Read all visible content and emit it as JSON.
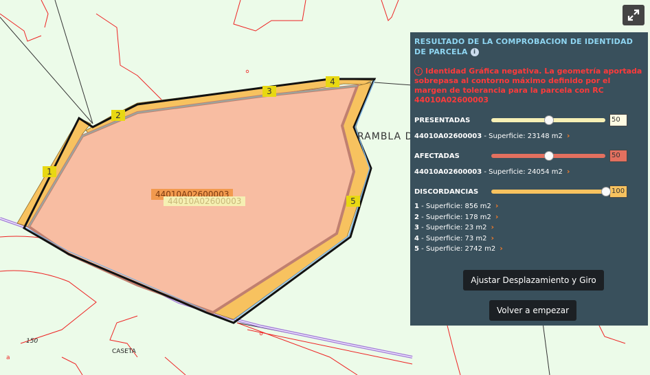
{
  "map": {
    "parcel_label_main": "44010A02600003",
    "parcel_label_shadow": "44010A02600003",
    "place_label": "RAMBLA D",
    "elevation_label": "150",
    "caseta_label": "CASETA",
    "red_letter": "a",
    "vertex_labels": [
      "1",
      "2",
      "3",
      "4",
      "5"
    ]
  },
  "toolbar": {
    "expand_icon": "expand-icon"
  },
  "panel": {
    "title_line1": "RESULTADO DE LA COMPROBACION DE IDENTIDAD",
    "title_line2": "DE PARCELA",
    "info_symbol": "i",
    "error_symbol": "!",
    "error_message": "Identidad Gráfica negativa. La geometría aportada sobrepasa al contorno máximo definido por el margen de tolerancia para la parcela con RC 44010A02600003",
    "presentadas": {
      "label": "PRESENTADAS",
      "value": "50",
      "level": 0.5,
      "track_color": "#f6f0b5",
      "item_code": "44010A02600003",
      "item_text": " - Superficie: 23148 m2"
    },
    "afectadas": {
      "label": "AFECTADAS",
      "value": "50",
      "level": 0.5,
      "track_color": "#e3705f",
      "item_code": "44010A02600003",
      "item_text": " - Superficie: 24054 m2"
    },
    "discordancias": {
      "label": "DISCORDANCIAS",
      "value": "100",
      "level": 1.0,
      "track_color": "#f7c25f",
      "items": [
        {
          "num": "1",
          "text": " - Superficie: 856 m2"
        },
        {
          "num": "2",
          "text": " - Superficie: 178 m2"
        },
        {
          "num": "3",
          "text": " - Superficie: 23 m2"
        },
        {
          "num": "4",
          "text": " - Superficie: 73 m2"
        },
        {
          "num": "5",
          "text": " - Superficie: 2742 m2"
        }
      ]
    },
    "chevron": "›",
    "adjust_button": "Ajustar Desplazamiento y Giro",
    "restart_button": "Volver a empezar"
  }
}
